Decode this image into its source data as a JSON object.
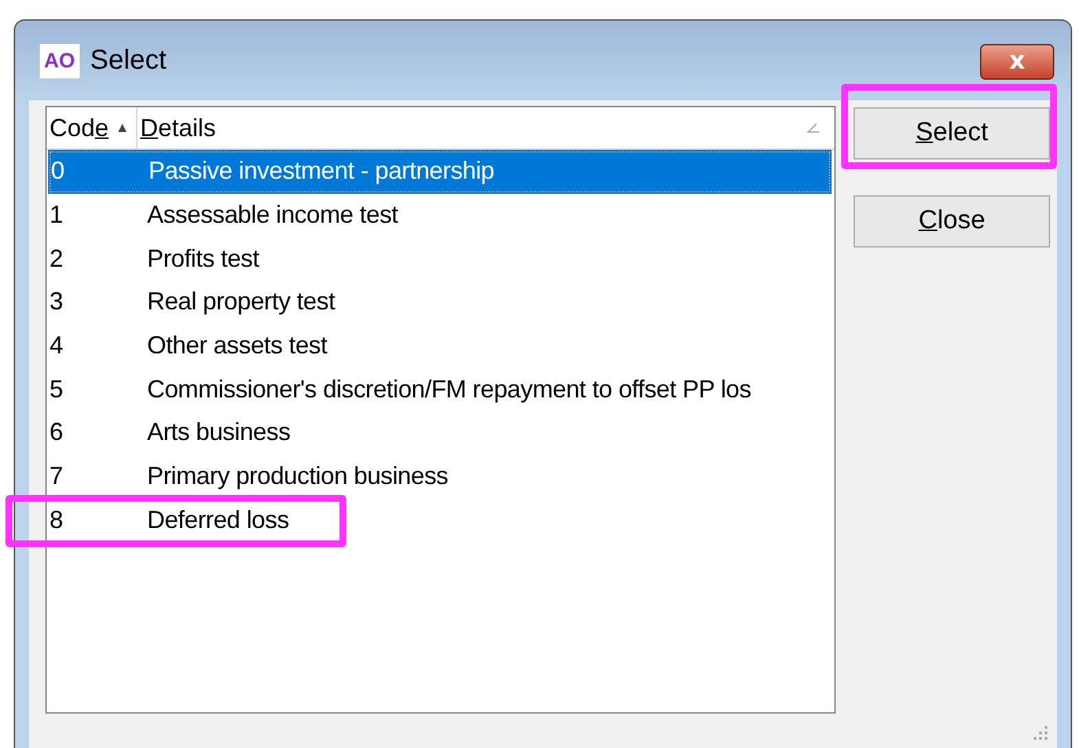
{
  "window": {
    "title": "Select",
    "close_glyph": "x"
  },
  "app_logo": "AO",
  "table": {
    "columns": [
      {
        "label": [
          {
            "text": "Cod",
            "underlined": false
          },
          {
            "text": "e",
            "underlined": true
          }
        ],
        "sorted": true
      },
      {
        "label": [
          {
            "text": "D",
            "underlined": true
          },
          {
            "text": "etails",
            "underlined": false
          }
        ],
        "sorted": false
      }
    ],
    "rows": [
      {
        "code": "0",
        "details": "Passive investment - partnership",
        "selected": true,
        "highlighted": false
      },
      {
        "code": "1",
        "details": "Assessable income test",
        "selected": false,
        "highlighted": false
      },
      {
        "code": "2",
        "details": "Profits test",
        "selected": false,
        "highlighted": false
      },
      {
        "code": "3",
        "details": "Real property test",
        "selected": false,
        "highlighted": false
      },
      {
        "code": "4",
        "details": "Other assets test",
        "selected": false,
        "highlighted": false
      },
      {
        "code": "5",
        "details": "Commissioner's discretion/FM repayment to offset PP los",
        "selected": false,
        "highlighted": false
      },
      {
        "code": "6",
        "details": "Arts business",
        "selected": false,
        "highlighted": false
      },
      {
        "code": "7",
        "details": "Primary production business",
        "selected": false,
        "highlighted": false
      },
      {
        "code": "8",
        "details": "Deferred loss",
        "selected": false,
        "highlighted": true
      }
    ]
  },
  "buttons": [
    {
      "label": [
        {
          "text": "S",
          "underlined": true
        },
        {
          "text": "elect",
          "underlined": false
        }
      ],
      "highlighted": true
    },
    {
      "label": [
        {
          "text": "C",
          "underlined": true
        },
        {
          "text": "lose",
          "underlined": false
        }
      ],
      "highlighted": false
    }
  ]
}
